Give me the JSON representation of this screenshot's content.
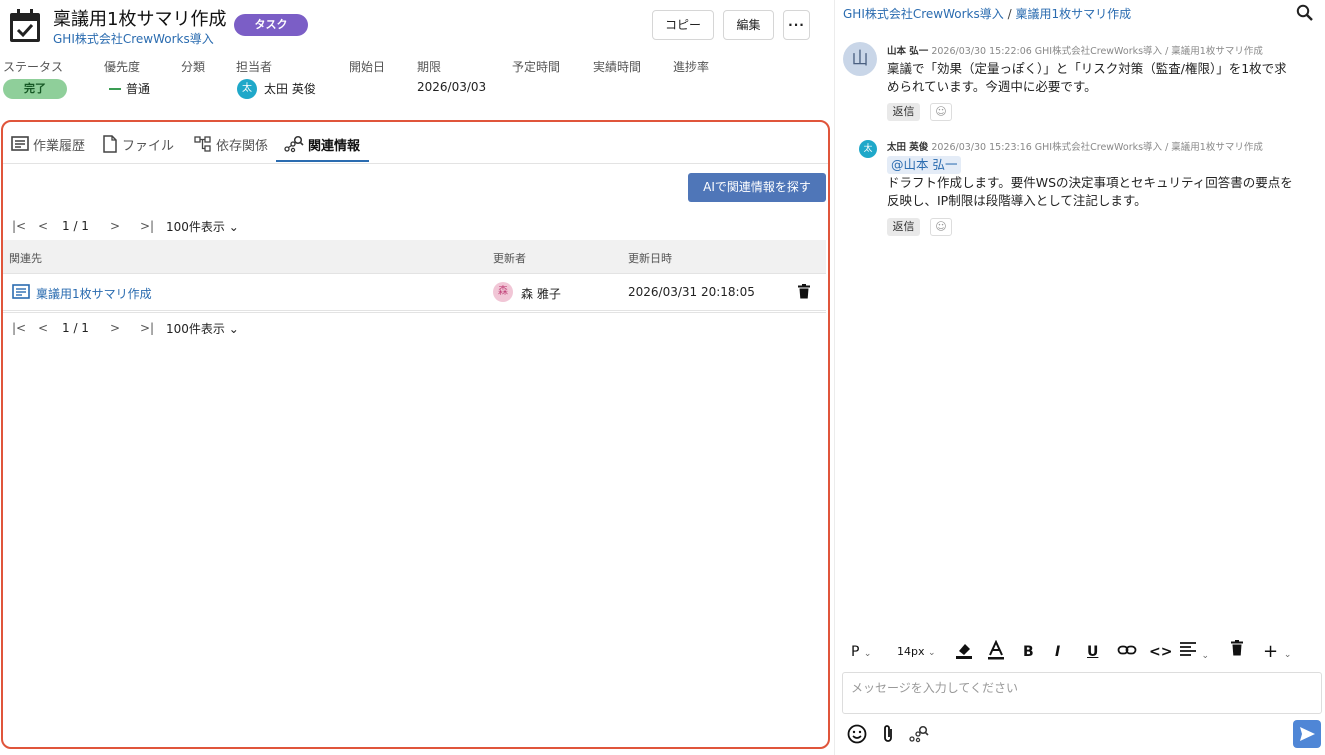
{
  "header": {
    "title": "稟議用1枚サマリ作成",
    "project": "GHI株式会社CrewWorks導入",
    "badge": "タスク",
    "buttons": {
      "copy": "コピー",
      "edit": "編集",
      "more": "···"
    }
  },
  "meta": {
    "labels": {
      "status": "ステータス",
      "priority": "優先度",
      "category": "分類",
      "assignee": "担当者",
      "start": "開始日",
      "due": "期限",
      "planned": "予定時間",
      "actual": "実績時間",
      "progress": "進捗率"
    },
    "values": {
      "status": "完了",
      "priority": "普通",
      "assignee_initial": "太",
      "assignee": "太田 英俊",
      "due": "2026/03/03"
    }
  },
  "tabs": [
    {
      "label": "作業履歴"
    },
    {
      "label": "ファイル"
    },
    {
      "label": "依存関係"
    },
    {
      "label": "関連情報"
    }
  ],
  "related": {
    "ai_button": "AIで関連情報を探す",
    "pager": {
      "first": "|<",
      "prev": "<",
      "info": "1 / 1",
      "next": ">",
      "last": ">|",
      "page_size": "100件表示 ⌄"
    },
    "columns": {
      "target": "関連先",
      "updater": "更新者",
      "updated": "更新日時"
    },
    "rows": [
      {
        "title": "稟議用1枚サマリ作成",
        "updater_initial": "森",
        "updater": "森 雅子",
        "updated": "2026/03/31 20:18:05"
      }
    ]
  },
  "chat": {
    "breadcrumb": {
      "project": "GHI株式会社CrewWorks導入",
      "sep": "/",
      "task": "稟議用1枚サマリ作成"
    },
    "comments": [
      {
        "initial": "山",
        "author": "山本 弘一",
        "meta": "2026/03/30 15:22:06  GHI株式会社CrewWorks導入 / 稟議用1枚サマリ作成",
        "line1": "稟議で「効果（定量っぽく）」と「リスク対策（監査/権限）」を1枚で求",
        "line2": "められています。今週中に必要です。",
        "reply": "返信",
        "react": "☺"
      },
      {
        "initial": "太",
        "author": "太田 英俊",
        "meta": "2026/03/30 15:23:16  GHI株式会社CrewWorks導入 / 稟議用1枚サマリ作成",
        "mention": "@山本 弘一",
        "line1": "ドラフト作成します。要件WSの決定事項とセキュリティ回答書の要点を",
        "line2": "反映し、IP制限は段階導入として注記します。",
        "reply": "返信",
        "react": "☺"
      }
    ],
    "editor": {
      "paragraph": "P",
      "font_size": "14px",
      "bold": "B",
      "italic": "I",
      "underline": "U",
      "code": "<>",
      "plus": "+",
      "placeholder": "メッセージを入力してください"
    }
  },
  "colors": {
    "accent": "#2b6cb0",
    "panel_border": "#e0553b",
    "badge": "#7b5ec6",
    "status": "#8fcf9a",
    "ai_button": "#4f76b8",
    "avatar_teal": "#1fa8c9",
    "avatar_pink": "#f1c6d6",
    "avatar_gray": "#c9d6e8"
  },
  "icons": [
    "calendar-check-icon",
    "history-icon",
    "file-icon",
    "dependency-icon",
    "related-icon",
    "link-icon",
    "trash-icon",
    "search-icon",
    "emoji-icon",
    "attach-icon",
    "send-icon"
  ]
}
